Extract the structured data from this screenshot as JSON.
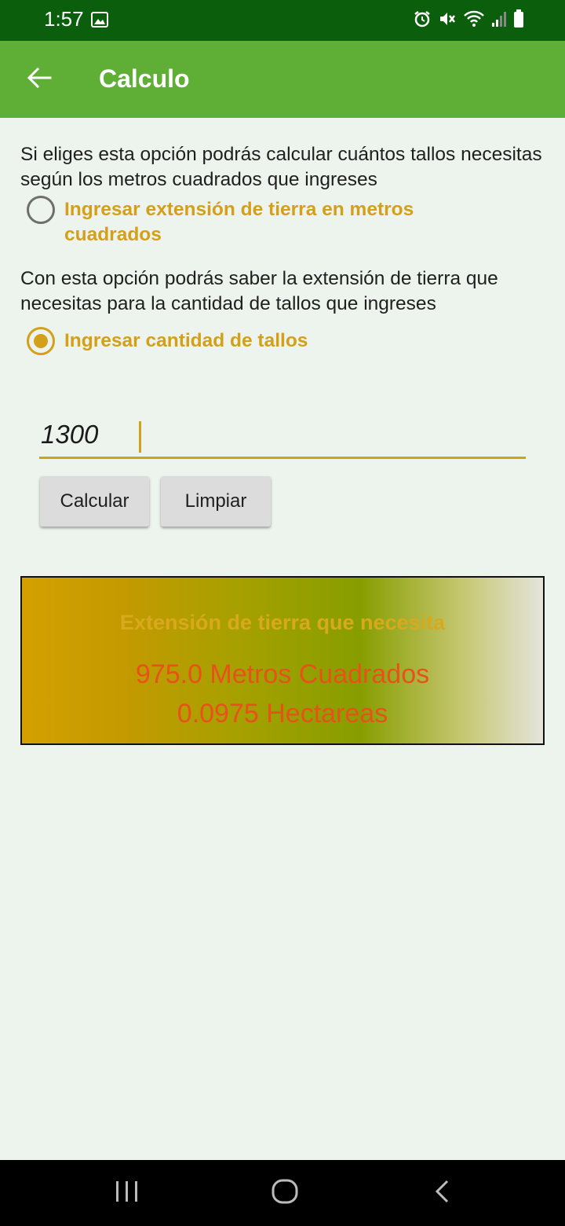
{
  "status_bar": {
    "time": "1:57"
  },
  "app_bar": {
    "title": "Calculo"
  },
  "options": {
    "option1_description": "Si eliges esta opción podrás calcular cuántos tallos necesitas según los metros cuadrados que ingreses",
    "option1_label": "Ingresar extensión de tierra en metros cuadrados",
    "option1_checked": false,
    "option2_description": "Con esta opción podrás saber la extensión de tierra que necesitas para la cantidad de tallos que ingreses",
    "option2_label": "Ingresar cantidad de tallos",
    "option2_checked": true
  },
  "input": {
    "value": "1300"
  },
  "buttons": {
    "calculate": "Calcular",
    "clear": "Limpiar"
  },
  "result": {
    "title": "Extensión de tierra que necesita",
    "square_meters": "975.0 Metros Cuadrados",
    "hectares": "0.0975 Hectareas"
  },
  "colors": {
    "status_bar": "#0B5E0B",
    "app_bar": "#5FAF36",
    "accent": "#D4A01A",
    "result_value": "#E8521A"
  }
}
